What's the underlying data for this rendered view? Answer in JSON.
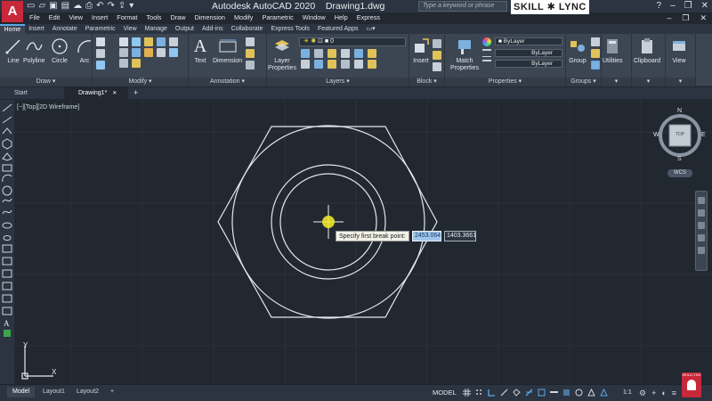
{
  "window": {
    "app_logo": "A",
    "title": "Autodesk AutoCAD 2020",
    "doc": "Drawing1.dwg",
    "search_placeholder": "Type a keyword or phrase",
    "brand_left": "SKILL",
    "brand_right": "LYNC"
  },
  "menu": [
    "File",
    "Edit",
    "View",
    "Insert",
    "Format",
    "Tools",
    "Draw",
    "Dimension",
    "Modify",
    "Parametric",
    "Window",
    "Help",
    "Express"
  ],
  "ribbon_tabs": [
    "Home",
    "Insert",
    "Annotate",
    "Parametric",
    "View",
    "Manage",
    "Output",
    "Add-ins",
    "Collaborate",
    "Express Tools",
    "Featured Apps"
  ],
  "panels": {
    "draw": {
      "label": "Draw",
      "tools": [
        "Line",
        "Polyline",
        "Circle",
        "Arc"
      ]
    },
    "modify": {
      "label": "Modify"
    },
    "annotation": {
      "label": "Annotation",
      "tools": [
        "Text",
        "Dimension"
      ]
    },
    "layers": {
      "label": "Layers",
      "tool": "Layer\nProperties",
      "current_layer": "0"
    },
    "block": {
      "label": "Block",
      "tool": "Insert"
    },
    "properties": {
      "label": "Properties",
      "tool": "Match\nProperties",
      "color": "ByLayer",
      "linetype": "ByLayer",
      "lineweight": "ByLayer"
    },
    "groups": {
      "label": "Groups",
      "tool": "Group"
    },
    "utilities": {
      "tool": "Utilities"
    },
    "clipboard": {
      "tool": "Clipboard"
    },
    "view": {
      "tool": "View"
    }
  },
  "file_tabs": [
    "Start",
    "Drawing1*"
  ],
  "viewport": {
    "label": "[−][Top][2D Wireframe]",
    "prompt": "Specify first break point:",
    "x_value": "2453.064",
    "y_value": "1403.3661"
  },
  "viewcube": {
    "n": "N",
    "s": "S",
    "e": "E",
    "w": "W",
    "face": "TOP",
    "wcs": "WCS"
  },
  "ucs": {
    "x": "X",
    "y": "Y"
  },
  "layout_tabs": [
    "Model",
    "Layout1",
    "Layout2"
  ],
  "status": {
    "model": "MODEL",
    "scale": "1:1",
    "notification": "SKILLLYNC"
  },
  "colors": {
    "accent": "#5ba7e6",
    "canvas": "#212830",
    "ribbon": "#3c4653",
    "brand_red": "#c8283a"
  }
}
